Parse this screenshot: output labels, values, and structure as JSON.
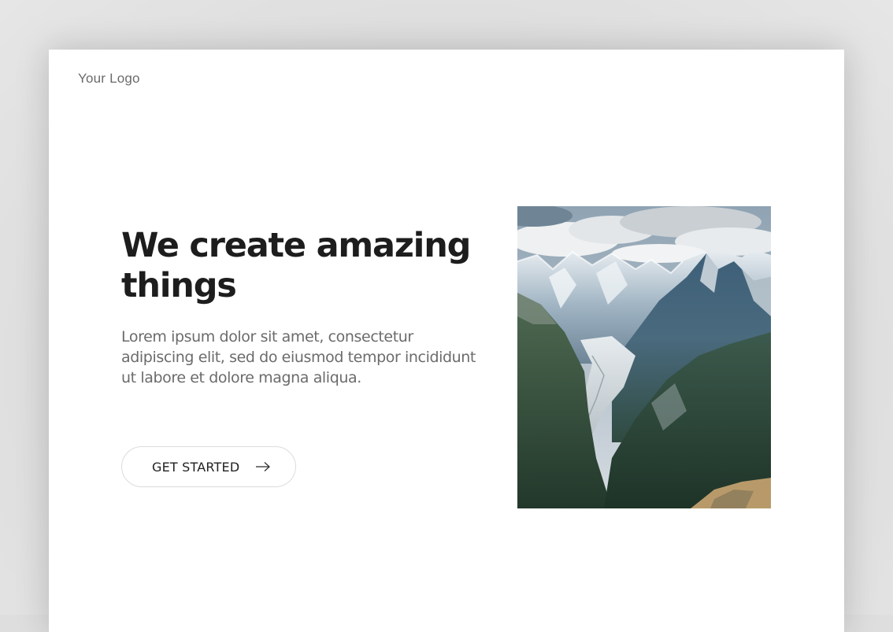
{
  "page": {
    "logo_text": "Your Logo"
  },
  "hero": {
    "headline": "We create amazing things",
    "lead": "Lorem ipsum dolor sit amet, consectetur adipiscing elit, sed do eiusmod tempor incididunt ut labore et dolore magna aliqua.",
    "cta_label": "GET STARTED",
    "cta_icon": "arrow-right-icon",
    "image_subject": "mountain-landscape"
  },
  "colors": {
    "backdrop": "#dedede",
    "card": "#ffffff",
    "headline": "#1d1d1d",
    "body_text": "#6b6b6b",
    "button_border": "#dcdcdc"
  }
}
